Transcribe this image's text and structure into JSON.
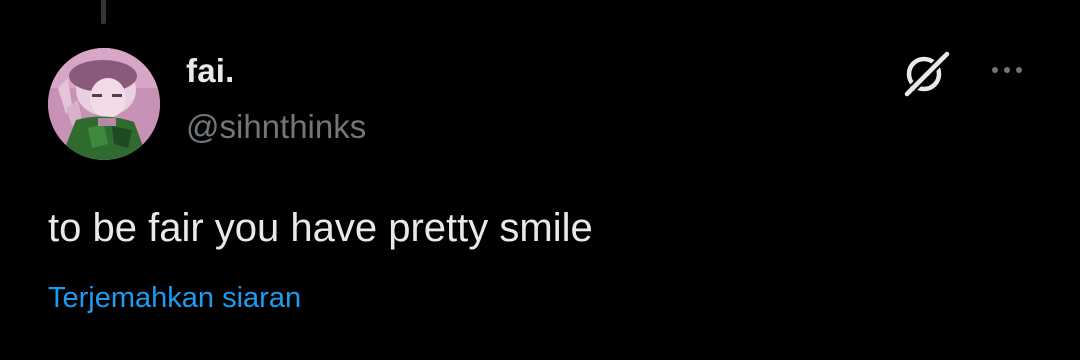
{
  "author": {
    "display_name": "fai.",
    "handle": "@sihnthinks",
    "avatar_icon": "profile-photo"
  },
  "post": {
    "text": "to be fair you have pretty smile",
    "translate_label": "Terjemahkan siaran"
  },
  "actions": {
    "grok_icon": "grok-icon",
    "more_icon": "more-dots-icon"
  },
  "colors": {
    "background": "#000000",
    "primary_text": "#e7e9ea",
    "secondary_text": "#71767b",
    "link": "#1d9bf0",
    "avatar_tint": "#c891b6"
  }
}
